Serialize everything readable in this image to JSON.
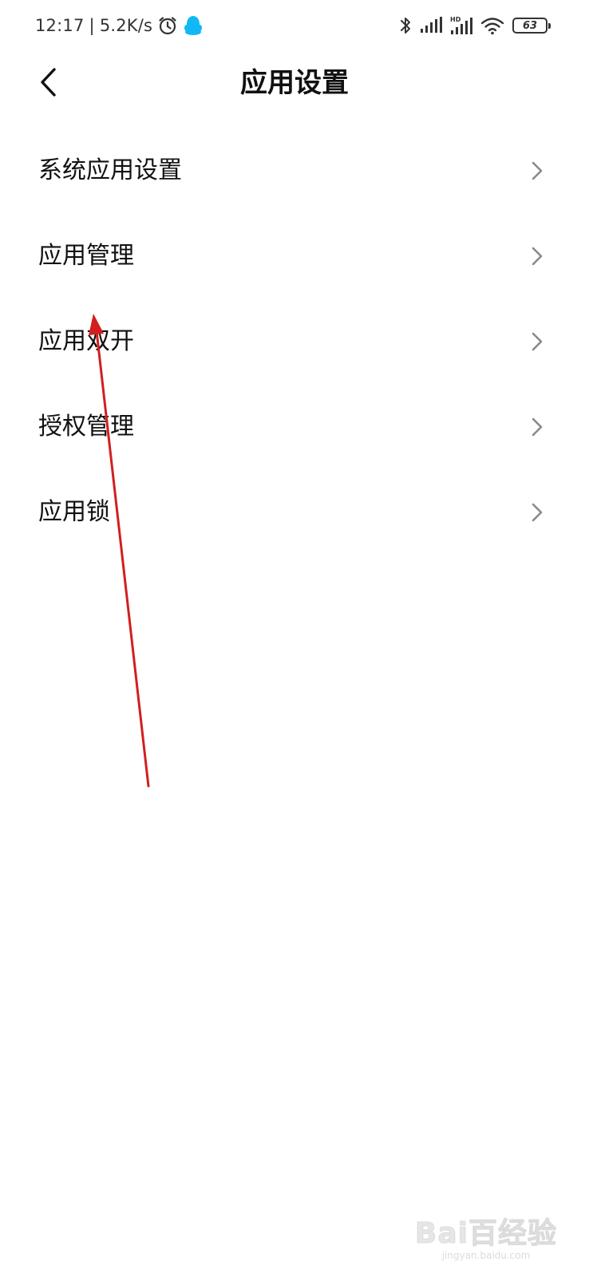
{
  "status_bar": {
    "time": "12:17",
    "separator": "|",
    "network_speed": "5.2K/s",
    "battery_level": "63",
    "icons": [
      "alarm-icon",
      "qq-icon",
      "bluetooth-icon",
      "signal-icon",
      "hd-signal-icon",
      "wifi-icon",
      "battery-icon"
    ],
    "qq_color": "#12B7F5"
  },
  "header": {
    "back_icon": "chevron-left-icon",
    "title": "应用设置"
  },
  "settings": {
    "items": [
      {
        "label": "系统应用设置",
        "icon": "chevron-right-icon"
      },
      {
        "label": "应用管理",
        "icon": "chevron-right-icon"
      },
      {
        "label": "应用双开",
        "icon": "chevron-right-icon"
      },
      {
        "label": "授权管理",
        "icon": "chevron-right-icon"
      },
      {
        "label": "应用锁",
        "icon": "chevron-right-icon"
      }
    ]
  },
  "annotation": {
    "type": "arrow",
    "color": "#d11f1f"
  },
  "watermark": {
    "logo": "Bai百经验",
    "url": "jingyan.baidu.com"
  }
}
